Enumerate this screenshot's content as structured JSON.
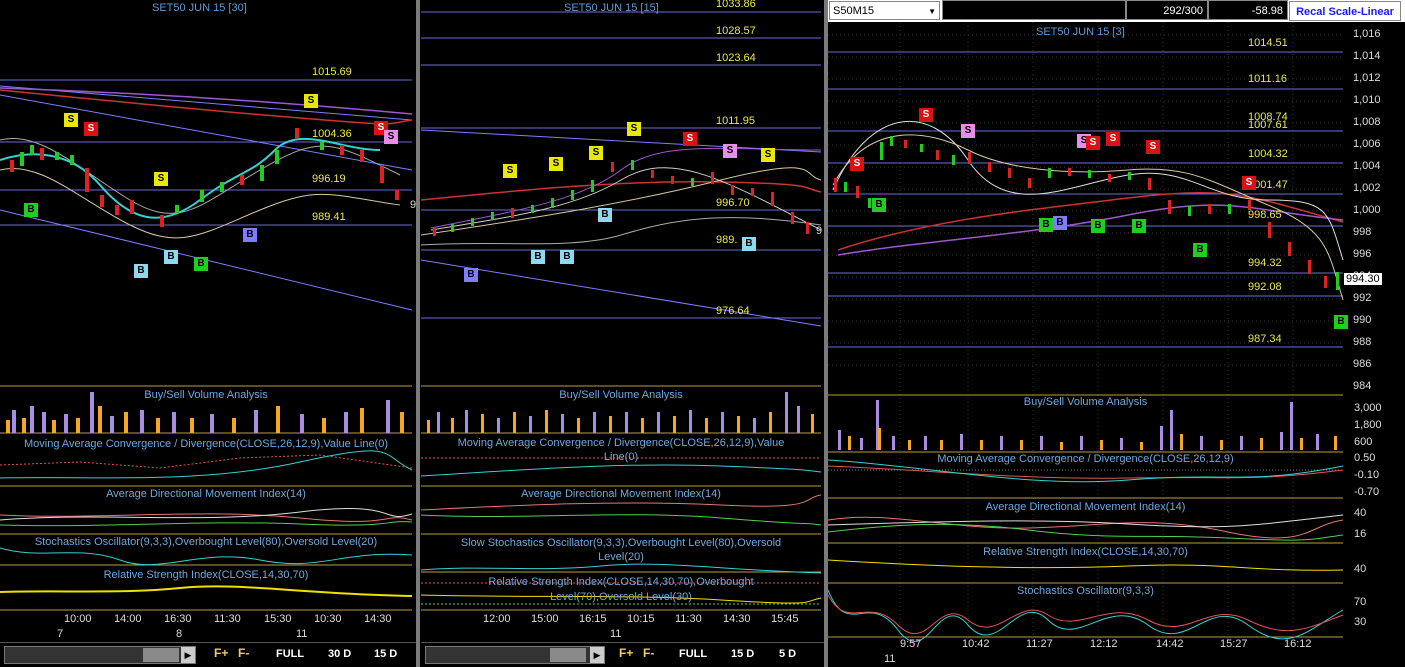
{
  "left_chart": {
    "title": "SET50 JUN 15  [30]",
    "levels": [
      "1015.69",
      "1004.36",
      "996.19",
      "989.41"
    ],
    "indicators": {
      "volume": "Buy/Sell Volume Analysis",
      "macd": "Moving Average Convergence / Divergence(CLOSE,26,12,9),Value Line(0)",
      "adx": "Average Directional Movement Index(14)",
      "stoch": "Stochastics Oscillator(9,3,3),Overbought Level(80),Oversold Level(20)",
      "rsi": "Relative Strength Index(CLOSE,14,30,70)"
    },
    "time_ticks": [
      "10:00",
      "14:00",
      "16:30",
      "11:30",
      "15:30",
      "10:30",
      "14:30"
    ],
    "date_ticks": [
      "7",
      "8",
      "11"
    ],
    "buttons": {
      "full": "FULL",
      "range1": "30 D",
      "range2": "15 D"
    },
    "edge_label": "9"
  },
  "mid_chart": {
    "title": "SET50 JUN 15  [15]",
    "levels": [
      "1033.86",
      "1028.57",
      "1023.64",
      "1011.95",
      "996.70",
      "989.",
      "976.64"
    ],
    "indicators": {
      "volume": "Buy/Sell Volume Analysis",
      "macd_line1": "Moving Average Convergence / Divergence(CLOSE,26,12,9),Value",
      "macd_line2": "Line(0)",
      "adx": "Average Directional Movement Index(14)",
      "stoch_line1": "Slow Stochastics Oscillator(9,3,3),Overbought Level(80),Oversold",
      "stoch_line2": "Level(20)",
      "rsi_line1": "Relative Strength Index(CLOSE,14,30,70),Overbought",
      "rsi_line2": "Level(70),Oversold Level(30)"
    },
    "time_ticks": [
      "12:00",
      "15:00",
      "16:15",
      "10:15",
      "11:30",
      "14:30",
      "15:45"
    ],
    "date_ticks": [
      "11"
    ],
    "buttons": {
      "full": "FULL",
      "range1": "15 D",
      "range2": "5 D"
    },
    "edge_label": "9"
  },
  "right_chart": {
    "symbol": "S50M15",
    "counter": "292/300",
    "change": "-58.98",
    "recal": "Recal Scale-Linear",
    "title": "SET50 JUN 15  [3]",
    "levels": [
      "1014.51",
      "1011.16",
      "1008.74",
      "1007.61",
      "1004.32",
      "1001.47",
      "998.65",
      "994.32",
      "992.08",
      "987.34"
    ],
    "price_axis": [
      "1,016",
      "1,014",
      "1,012",
      "1,010",
      "1,008",
      "1,006",
      "1,004",
      "1,002",
      "1,000",
      "998",
      "996",
      "994",
      "992",
      "990",
      "988",
      "986",
      "984"
    ],
    "current_price": "994.30",
    "indicators": {
      "volume": "Buy/Sell Volume Analysis",
      "macd": "Moving Average Convergence / Divergence(CLOSE,26,12,9)",
      "adx": "Average Directional Movement Index(14)",
      "rsi": "Relative Strength Index(CLOSE,14,30,70)",
      "stoch": "Stochastics Oscillator(9,3,3)"
    },
    "vol_axis": [
      "3,000",
      "1,800",
      "600"
    ],
    "macd_axis": [
      "0.50",
      "-0.10",
      "-0.70"
    ],
    "adx_axis": [
      "40",
      "16"
    ],
    "rsi_axis": [
      "40"
    ],
    "stoch_axis": [
      "70",
      "30"
    ],
    "time_ticks": [
      "9:57",
      "10:42",
      "11:27",
      "12:12",
      "14:42",
      "15:27",
      "16:12"
    ],
    "date_ticks": [
      "11"
    ]
  },
  "signals": {
    "buy": "B",
    "sell": "S"
  },
  "toolbar": {
    "f_plus": "F+",
    "f_minus": "F-"
  },
  "colors": {
    "buy": "#22cc22",
    "sell": "#dd1111",
    "neutral_sell": "#e8e800",
    "level_line": "#6b6bd6",
    "grid": "#444444"
  }
}
